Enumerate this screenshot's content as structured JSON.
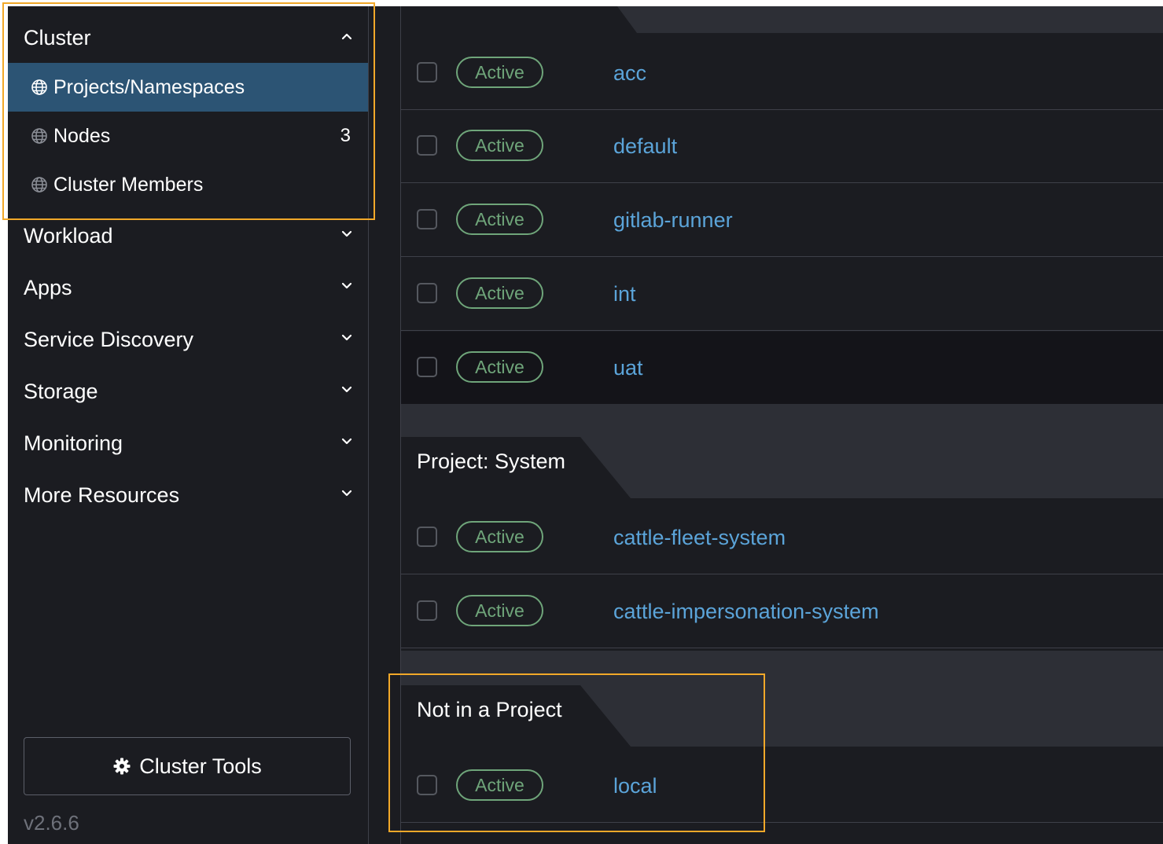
{
  "sidebar": {
    "cluster_group": {
      "label": "Cluster",
      "icon": "chevron-up-icon"
    },
    "cluster_items": [
      {
        "label": "Projects/Namespaces",
        "icon": "globe-icon",
        "active": true,
        "count": ""
      },
      {
        "label": "Nodes",
        "icon": "globe-icon",
        "active": false,
        "count": "3"
      },
      {
        "label": "Cluster Members",
        "icon": "globe-icon",
        "active": false,
        "count": ""
      }
    ],
    "groups": [
      {
        "label": "Workload",
        "icon": "chevron-down-icon"
      },
      {
        "label": "Apps",
        "icon": "chevron-down-icon"
      },
      {
        "label": "Service Discovery",
        "icon": "chevron-down-icon"
      },
      {
        "label": "Storage",
        "icon": "chevron-down-icon"
      },
      {
        "label": "Monitoring",
        "icon": "chevron-down-icon"
      },
      {
        "label": "More Resources",
        "icon": "chevron-down-icon"
      }
    ],
    "cluster_tools": {
      "label": "Cluster Tools",
      "icon": "gear-icon"
    },
    "version": "v2.6.6"
  },
  "main": {
    "groups": [
      {
        "title": "",
        "rows": [
          {
            "status": "Active",
            "name": "acc"
          },
          {
            "status": "Active",
            "name": "default"
          },
          {
            "status": "Active",
            "name": "gitlab-runner"
          },
          {
            "status": "Active",
            "name": "int"
          },
          {
            "status": "Active",
            "name": "uat"
          }
        ]
      },
      {
        "title": "Project: System",
        "rows": [
          {
            "status": "Active",
            "name": "cattle-fleet-system"
          },
          {
            "status": "Active",
            "name": "cattle-impersonation-system"
          }
        ]
      },
      {
        "title": "Not in a Project",
        "rows": [
          {
            "status": "Active",
            "name": "local"
          }
        ]
      }
    ]
  },
  "colors": {
    "background": "#1b1c21",
    "active_nav": "#2c5474",
    "status_green": "#6fa57a",
    "link_blue": "#5ba4d9",
    "highlight": "#f2a829"
  }
}
